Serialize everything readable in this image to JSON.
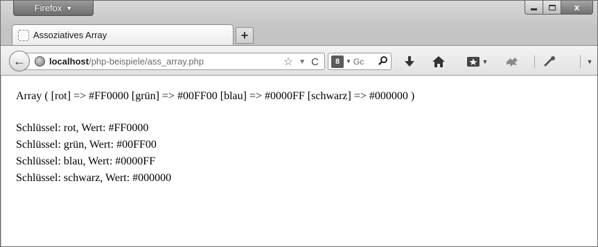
{
  "window": {
    "app_menu_label": "Firefox",
    "app_menu_caret": "▼",
    "minimize_label": "",
    "maximize_label": "",
    "close_label": "x"
  },
  "tabs": [
    {
      "title": "Assoziatives Array",
      "active": true
    }
  ],
  "new_tab_label": "+",
  "toolbar": {
    "back_glyph": "←",
    "url_host": "localhost",
    "url_path": "/php-beispiele/ass_array.php",
    "bookmark_star": "☆",
    "history_dropmarker": "▼",
    "reload_glyph": "C",
    "search_engine_icon": "8",
    "search_engine_caret": "▼",
    "search_placeholder": "Gc",
    "search_glass": "⚲",
    "icons": [
      "download-icon",
      "home-icon",
      "bookmarks-menu-icon",
      "addon-icon",
      "tools-icon"
    ]
  },
  "content": {
    "print_r_output": "Array ( [rot] => #FF0000 [grün] => #00FF00 [blau] => #0000FF [schwarz] => #000000 )",
    "lines": [
      "Schlüssel: rot, Wert: #FF0000",
      "Schlüssel: grün, Wert: #00FF00",
      "Schlüssel: blau, Wert: #0000FF",
      "Schlüssel: schwarz, Wert: #000000"
    ]
  }
}
